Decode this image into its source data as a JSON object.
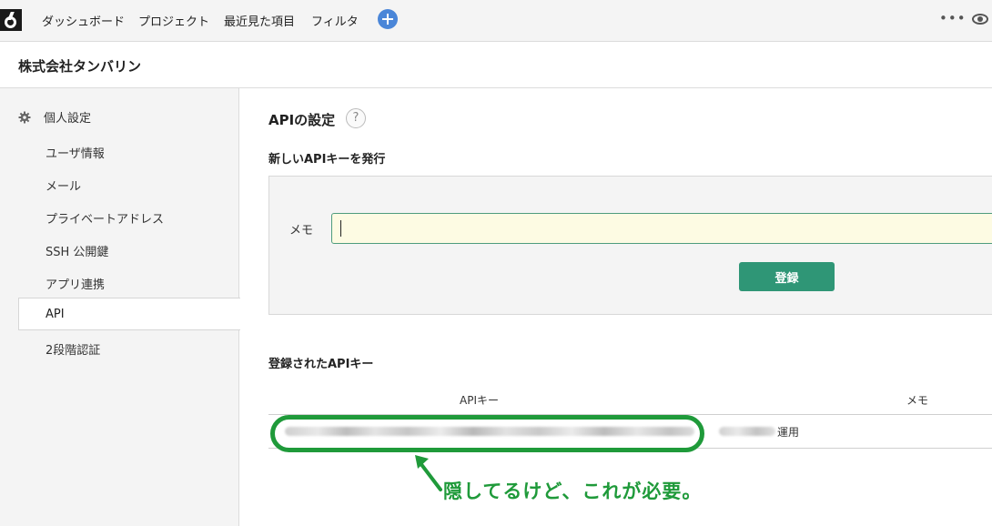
{
  "nav": {
    "items": [
      "ダッシュボード",
      "プロジェクト",
      "最近見た項目",
      "フィルタ"
    ],
    "more": "•••"
  },
  "org": {
    "name": "株式会社タンバリン"
  },
  "sidebar": {
    "section": "個人設定",
    "items": [
      "ユーザ情報",
      "メール",
      "プライベートアドレス",
      "SSH 公開鍵",
      "アプリ連携",
      "API",
      "2段階認証"
    ],
    "active": "API"
  },
  "main": {
    "title": "APIの設定",
    "help": "?",
    "new_key_title": "新しいAPIキーを発行",
    "memo_label": "メモ",
    "memo_value": "",
    "submit_label": "登録",
    "registered_title": "登録されたAPIキー",
    "columns": {
      "key": "APIキー",
      "memo": "メモ"
    },
    "rows": [
      {
        "memo_visible_suffix": "運用"
      }
    ]
  },
  "annotation": {
    "text": "隠してるけど、これが必要。"
  },
  "colors": {
    "accent_green": "#2f9676",
    "annotation_green": "#1f9a3a",
    "nav_add_blue": "#4a86d8"
  }
}
